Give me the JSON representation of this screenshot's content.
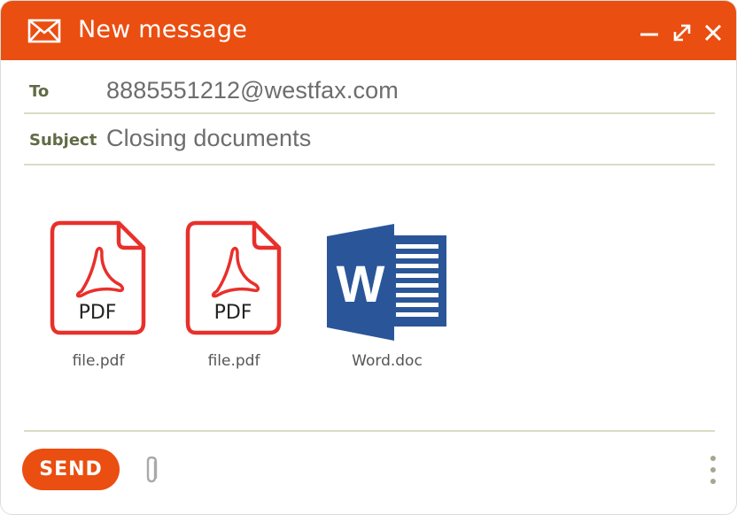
{
  "window": {
    "title": "New message",
    "icon": "envelope-icon",
    "controls": [
      "minimize-icon",
      "maximize-icon",
      "close-icon"
    ]
  },
  "fields": {
    "to_label": "To",
    "to_value": "8885551212@westfax.com",
    "subject_label": "Subject",
    "subject_value": "Closing documents"
  },
  "attachments": [
    {
      "name": "file.pdf",
      "icon": "pdf-file-icon",
      "badge": "PDF"
    },
    {
      "name": "file.pdf",
      "icon": "pdf-file-icon",
      "badge": "PDF"
    },
    {
      "name": "Word.doc",
      "icon": "word-document-icon",
      "badge": "W"
    }
  ],
  "toolbar": {
    "send_label": "SEND",
    "attach_icon": "paperclip-icon",
    "more_icon": "more-vertical-icon"
  },
  "colors": {
    "accent": "#ea4e10",
    "pdf_red": "#e8302b",
    "word_blue": "#2a5699",
    "label_olive": "#616b45",
    "divider": "#d7dcc4"
  }
}
